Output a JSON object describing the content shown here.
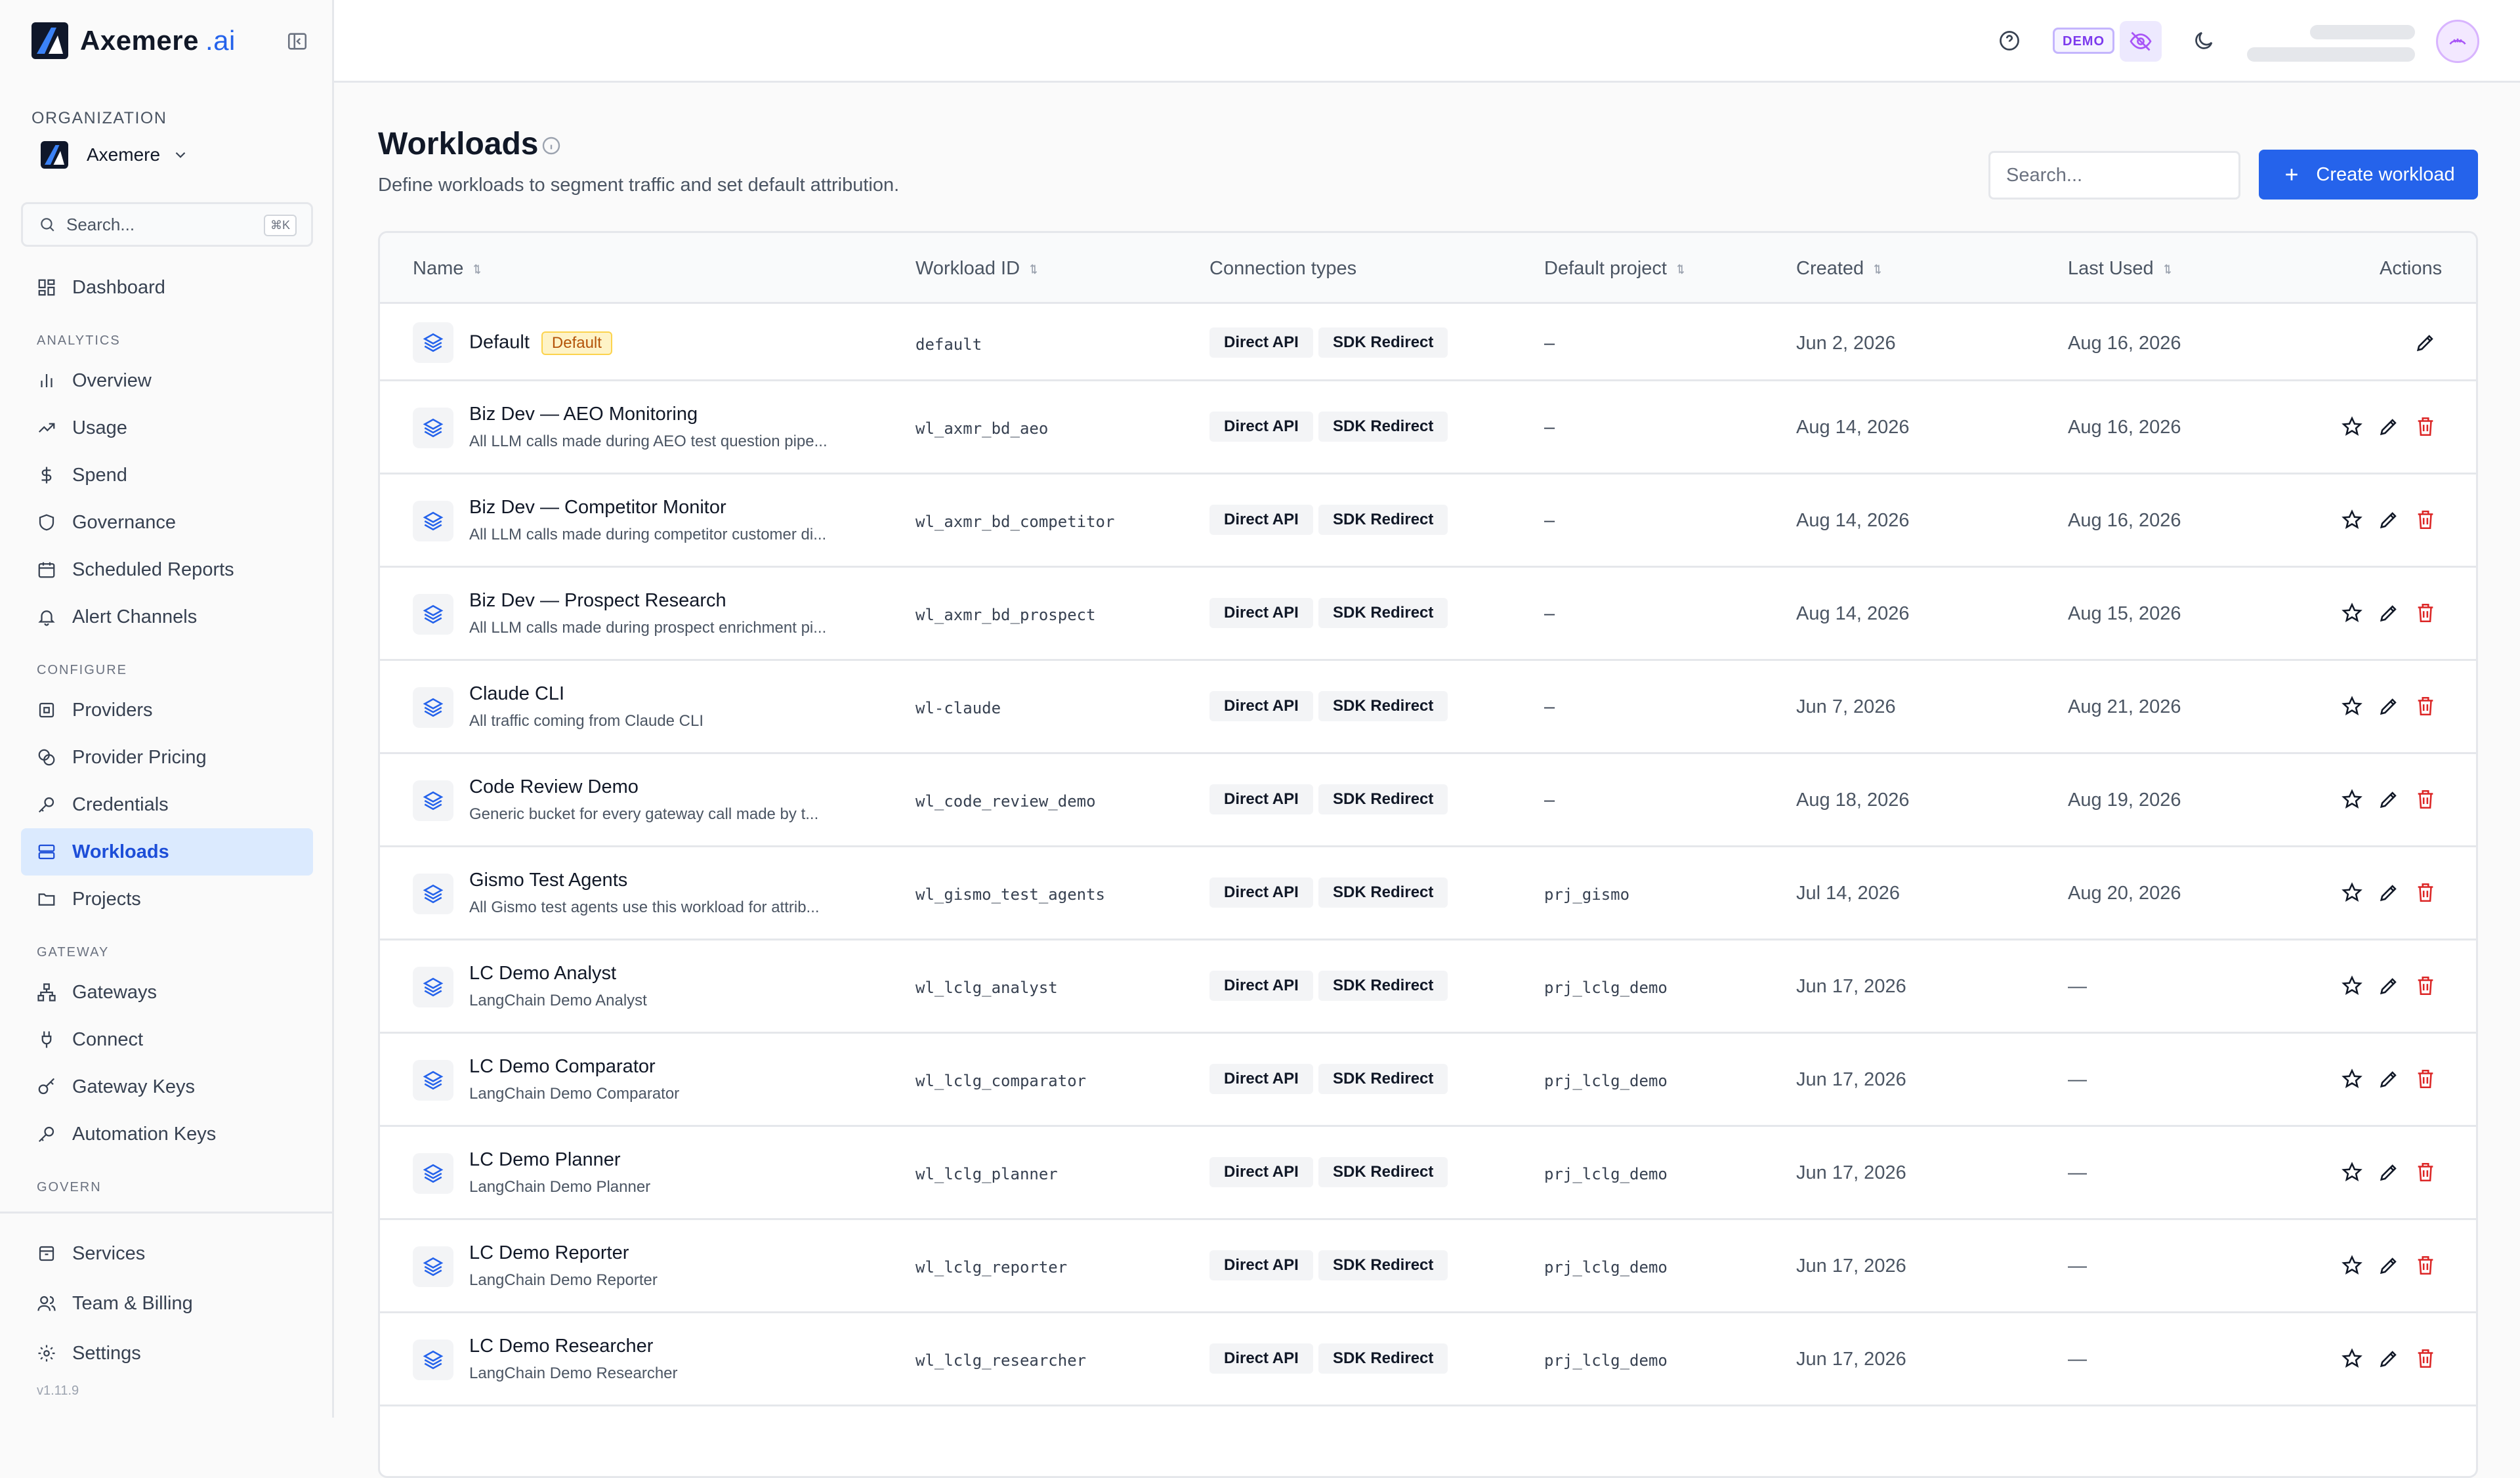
{
  "app": {
    "brand": "Axemere",
    "brand_suffix": ".ai",
    "version": "v1.11.9",
    "accent": "#2563eb"
  },
  "sidebar": {
    "org_label": "ORGANIZATION",
    "org_name": "Axemere",
    "search_placeholder": "Search...",
    "search_shortcut": "⌘K",
    "dashboard": "Dashboard",
    "sections": {
      "analytics": "ANALYTICS",
      "configure": "CONFIGURE",
      "gateway": "GATEWAY",
      "govern": "GOVERN"
    },
    "items": {
      "overview": "Overview",
      "usage": "Usage",
      "spend": "Spend",
      "governance": "Governance",
      "scheduled_reports": "Scheduled Reports",
      "alert_channels": "Alert Channels",
      "providers": "Providers",
      "provider_pricing": "Provider Pricing",
      "credentials": "Credentials",
      "workloads": "Workloads",
      "projects": "Projects",
      "gateways": "Gateways",
      "connect": "Connect",
      "gateway_keys": "Gateway Keys",
      "automation_keys": "Automation Keys",
      "services": "Services",
      "team_billing": "Team & Billing",
      "settings": "Settings"
    }
  },
  "topbar": {
    "demo_badge": "DEMO"
  },
  "page": {
    "title": "Workloads",
    "description": "Define workloads to segment traffic and set default attribution.",
    "search_placeholder": "Search...",
    "create_button": "Create workload"
  },
  "table": {
    "columns": {
      "name": "Name",
      "workload_id": "Workload ID",
      "connection_types": "Connection types",
      "default_project": "Default project",
      "created": "Created",
      "last_used": "Last Used",
      "actions": "Actions"
    },
    "rows": [
      {
        "name": "Default",
        "badge": "Default",
        "desc": "",
        "id": "default",
        "conn1": "Direct API",
        "conn2": "SDK Redirect",
        "project": "–",
        "created": "Jun 2, 2026",
        "last_used": "Aug 16, 2026"
      },
      {
        "name": "Biz Dev — AEO Monitoring",
        "desc": "All LLM calls made during AEO test question pipe...",
        "id": "wl_axmr_bd_aeo",
        "conn1": "Direct API",
        "conn2": "SDK Redirect",
        "project": "–",
        "created": "Aug 14, 2026",
        "last_used": "Aug 16, 2026"
      },
      {
        "name": "Biz Dev — Competitor Monitor",
        "desc": "All LLM calls made during competitor customer di...",
        "id": "wl_axmr_bd_competitor",
        "conn1": "Direct API",
        "conn2": "SDK Redirect",
        "project": "–",
        "created": "Aug 14, 2026",
        "last_used": "Aug 16, 2026"
      },
      {
        "name": "Biz Dev — Prospect Research",
        "desc": "All LLM calls made during prospect enrichment pi...",
        "id": "wl_axmr_bd_prospect",
        "conn1": "Direct API",
        "conn2": "SDK Redirect",
        "project": "–",
        "created": "Aug 14, 2026",
        "last_used": "Aug 15, 2026"
      },
      {
        "name": "Claude CLI",
        "desc": "All traffic coming from Claude CLI",
        "id": "wl-claude",
        "conn1": "Direct API",
        "conn2": "SDK Redirect",
        "project": "–",
        "created": "Jun 7, 2026",
        "last_used": "Aug 21, 2026"
      },
      {
        "name": "Code Review Demo",
        "desc": "Generic bucket for every gateway call made by t...",
        "id": "wl_code_review_demo",
        "conn1": "Direct API",
        "conn2": "SDK Redirect",
        "project": "–",
        "created": "Aug 18, 2026",
        "last_used": "Aug 19, 2026"
      },
      {
        "name": "Gismo Test Agents",
        "desc": "All Gismo test agents use this workload for attrib...",
        "id": "wl_gismo_test_agents",
        "conn1": "Direct API",
        "conn2": "SDK Redirect",
        "project": "prj_gismo",
        "created": "Jul 14, 2026",
        "last_used": "Aug 20, 2026"
      },
      {
        "name": "LC Demo Analyst",
        "desc": "LangChain Demo Analyst",
        "id": "wl_lclg_analyst",
        "conn1": "Direct API",
        "conn2": "SDK Redirect",
        "project": "prj_lclg_demo",
        "created": "Jun 17, 2026",
        "last_used": "—"
      },
      {
        "name": "LC Demo Comparator",
        "desc": "LangChain Demo Comparator",
        "id": "wl_lclg_comparator",
        "conn1": "Direct API",
        "conn2": "SDK Redirect",
        "project": "prj_lclg_demo",
        "created": "Jun 17, 2026",
        "last_used": "—"
      },
      {
        "name": "LC Demo Planner",
        "desc": "LangChain Demo Planner",
        "id": "wl_lclg_planner",
        "conn1": "Direct API",
        "conn2": "SDK Redirect",
        "project": "prj_lclg_demo",
        "created": "Jun 17, 2026",
        "last_used": "—"
      },
      {
        "name": "LC Demo Reporter",
        "desc": "LangChain Demo Reporter",
        "id": "wl_lclg_reporter",
        "conn1": "Direct API",
        "conn2": "SDK Redirect",
        "project": "prj_lclg_demo",
        "created": "Jun 17, 2026",
        "last_used": "—"
      },
      {
        "name": "LC Demo Researcher",
        "desc": "LangChain Demo Researcher",
        "id": "wl_lclg_researcher",
        "conn1": "Direct API",
        "conn2": "SDK Redirect",
        "project": "prj_lclg_demo",
        "created": "Jun 17, 2026",
        "last_used": "—"
      }
    ]
  }
}
